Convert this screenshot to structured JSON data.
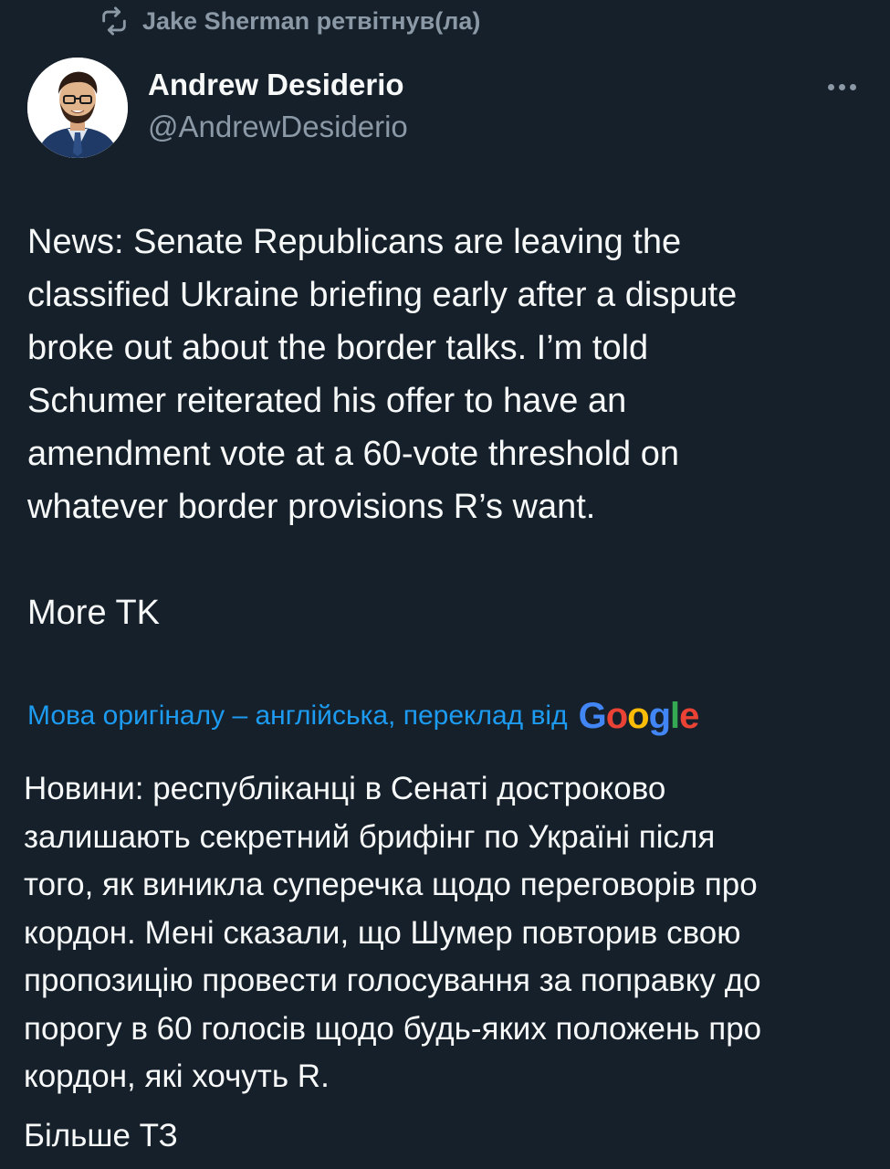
{
  "retweet": {
    "icon": "retweet-icon",
    "text": "Jake Sherman ретвітнув(ла)"
  },
  "author": {
    "name": "Andrew Desiderio",
    "handle": "@AndrewDesiderio",
    "avatar_icon": "profile-photo"
  },
  "more_icon": "more-options-icon",
  "tweet": {
    "body": "News: Senate Republicans are leaving the\nclassified Ukraine briefing early after a dispute\nbroke out about the border talks. I’m told\nSchumer reiterated his offer to have an\namendment vote at a 60-vote threshold on\nwhatever border provisions R’s want.",
    "more": "More TK"
  },
  "translation": {
    "note": "Мова оригіналу – англійська, переклад від",
    "provider_logo": "Google",
    "body": "Новини: республіканці в Сенаті достроково\nзалишають секретний брифінг по Україні після\nтого, як виникла суперечка щодо переговорів про\nкордон. Мені сказали, що Шумер повторив свою\nпропозицію провести голосування за поправку до\nпорогу в 60 голосів щодо будь-яких положень про\nкордон, які хочуть R.",
    "more": "Більше ТЗ"
  },
  "colors": {
    "background": "#15202b",
    "text": "#f7f9f9",
    "muted": "#8b98a5",
    "link": "#1d9bf0"
  }
}
